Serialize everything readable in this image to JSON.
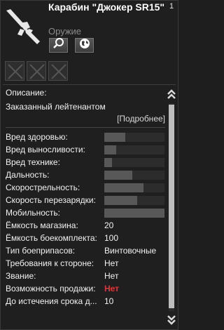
{
  "header": {
    "title": "Карабин \"Джокер SR15\"",
    "category": "Оружие",
    "count": "1",
    "buttons": [
      {
        "icon": "magnifier-icon"
      },
      {
        "icon": "globe-icon"
      }
    ]
  },
  "slots": [
    {
      "icon": "empty-slot-x-icon"
    },
    {
      "icon": "empty-slot-x-icon"
    },
    {
      "icon": "empty-slot-x-icon"
    }
  ],
  "description": {
    "label": "Описание:",
    "text": "Заказанный лейтенантом",
    "more_link": "[Подробнее]"
  },
  "stats": [
    {
      "label": "Вред здоровью:",
      "level": 0.35
    },
    {
      "label": "Вред выносливости:",
      "level": 0.2
    },
    {
      "label": "Вред технике:",
      "level": 0.13
    },
    {
      "label": "Дальность:",
      "level": 0.47
    },
    {
      "label": "Скорострельность:",
      "level": 0.65
    },
    {
      "label": "Скорость перезарядки:",
      "level": 0.55
    },
    {
      "label": "Мобильность:",
      "level": 1.0
    }
  ],
  "properties": [
    {
      "label": "Ёмкость магазина:",
      "value": "20"
    },
    {
      "label": "Ёмкость боекомплекта:",
      "value": "100"
    },
    {
      "label": "Тип боеприпасов:",
      "value": "Винтовочные"
    },
    {
      "label": "Требования к стороне:",
      "value": "Нет"
    },
    {
      "label": "Звание:",
      "value": "Нет"
    },
    {
      "label": "Возможность продажи:",
      "value": "Нет",
      "color": "#e23636"
    },
    {
      "label": "До истечения срока д...",
      "value": "10"
    }
  ],
  "colors": {
    "background": "#1f1f1f",
    "bar_fill": "#585858",
    "warning": "#e23636"
  }
}
